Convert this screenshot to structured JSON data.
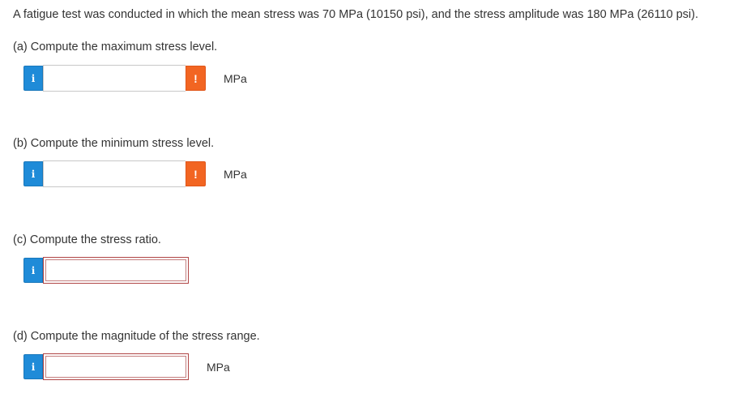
{
  "problem": {
    "text": "A fatigue test was conducted in which the mean stress was 70 MPa (10150 psi), and the stress amplitude was 180 MPa (26110 psi)."
  },
  "parts": [
    {
      "question": "(a) Compute the maximum stress level.",
      "value": "",
      "unit": "MPa",
      "info_icon": "i",
      "warning_icon": "!"
    },
    {
      "question": "(b) Compute the minimum stress level.",
      "value": "",
      "unit": "MPa",
      "info_icon": "i",
      "warning_icon": "!"
    },
    {
      "question": "(c) Compute the stress ratio.",
      "value": "",
      "info_icon": "i"
    },
    {
      "question": "(d) Compute the magnitude of the stress range.",
      "value": "",
      "unit": "MPa",
      "info_icon": "i"
    }
  ],
  "colors": {
    "info_button": "#1f8bd8",
    "warning_button": "#f26522",
    "error_border": "#b04444"
  }
}
